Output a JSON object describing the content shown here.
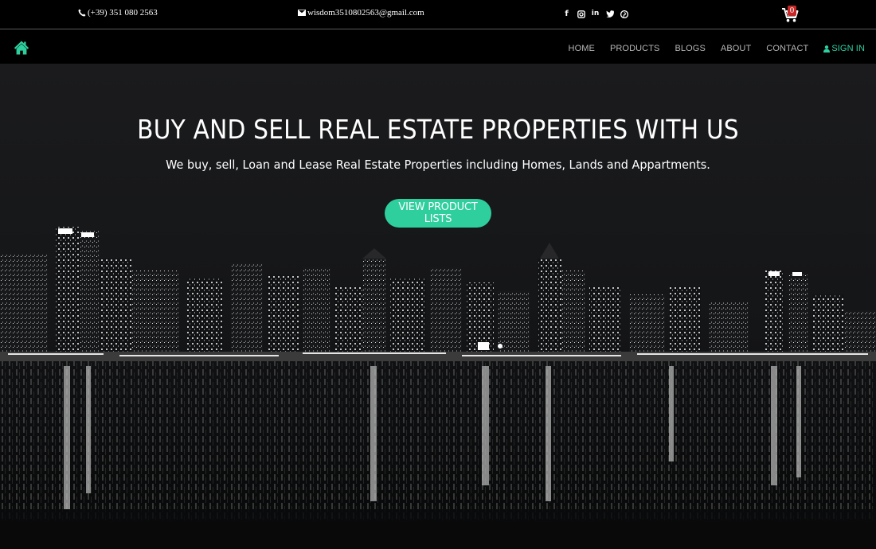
{
  "topbar": {
    "phone": "(+39) 351 080 2563",
    "email": "wisdom3510802563@gmail.com",
    "socials": [
      {
        "name": "facebook-icon",
        "glyph": "f"
      },
      {
        "name": "instagram-icon",
        "glyph": "◘"
      },
      {
        "name": "linkedin-icon",
        "glyph": "in"
      },
      {
        "name": "twitter-icon",
        "glyph": "t"
      },
      {
        "name": "pinterest-icon",
        "glyph": "℗"
      }
    ],
    "cart_count": "0"
  },
  "nav": {
    "links": [
      "HOME",
      "PRODUCTS",
      "BLOGS",
      "ABOUT",
      "CONTACT"
    ],
    "signin": "SIGN IN"
  },
  "hero": {
    "title": "BUY AND SELL REAL ESTATE PROPERTIES WITH US",
    "subtitle": "We buy, sell, Loan and Lease Real Estate Properties including Homes, Lands and Appartments.",
    "button": "VIEW PRODUCT LISTS"
  },
  "colors": {
    "accent": "#2ecf9d",
    "badge": "#c62828",
    "nav_text": "#b5b5b5"
  }
}
